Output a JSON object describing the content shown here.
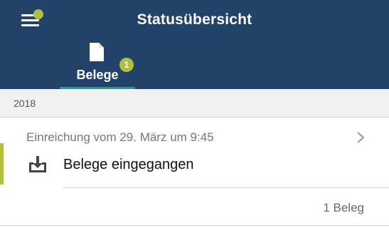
{
  "header": {
    "title": "Statusübersicht",
    "menu_icon": "hamburger-menu-icon",
    "menu_notification_color": "#b3be3e",
    "background_color": "#234269"
  },
  "tabs": [
    {
      "label": "Belege",
      "icon": "document-icon",
      "badge": "1",
      "active": true
    }
  ],
  "section": {
    "year": "2018"
  },
  "entry": {
    "subtitle": "Einreichung vom 29. März um 9:45",
    "icon": "inbox-download-icon",
    "title": "Belege eingegangen",
    "count": "1 Beleg",
    "accent_color": "#b3be3e"
  }
}
